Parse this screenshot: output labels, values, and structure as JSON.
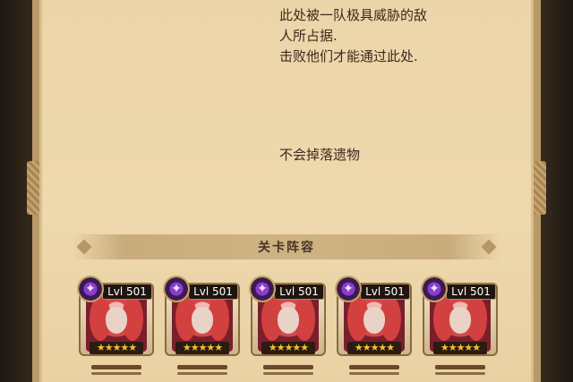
{
  "description": {
    "line1": "此处被一队极具威胁的敌",
    "line2": "人所占据.",
    "line3": "击败他们才能通过此处."
  },
  "drop_text": "不会掉落遗物",
  "section": {
    "title": "关卡阵容"
  },
  "roster": {
    "heroes": [
      {
        "level": "Lvl 501",
        "stars": "★★★★★",
        "faction_icon": "dark-faction-icon"
      },
      {
        "level": "Lvl 501",
        "stars": "★★★★★",
        "faction_icon": "dark-faction-icon"
      },
      {
        "level": "Lvl 501",
        "stars": "★★★★★",
        "faction_icon": "dark-faction-icon"
      },
      {
        "level": "Lvl 501",
        "stars": "★★★★★",
        "faction_icon": "dark-faction-icon"
      },
      {
        "level": "Lvl 501",
        "stars": "★★★★★",
        "faction_icon": "dark-faction-icon"
      }
    ]
  },
  "colors": {
    "parchment": "#eed8ad",
    "accent_red": "#d24a4a",
    "star": "#f2c230"
  }
}
